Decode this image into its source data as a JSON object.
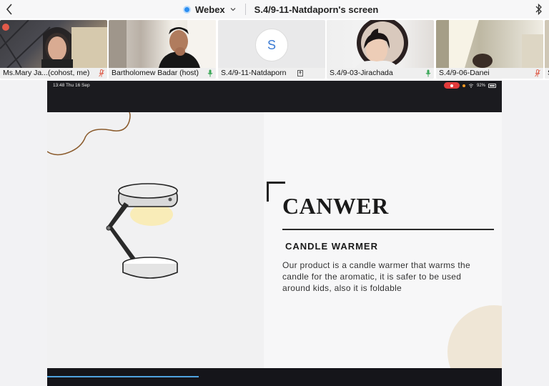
{
  "topbar": {
    "app_name": "Webex",
    "share_title": "S.4/9-11-Natdaporn's screen"
  },
  "participants": [
    {
      "label": "Ms.Mary Ja...(cohost, me)",
      "mic": "muted"
    },
    {
      "label": "Bartholomew Badar (host)",
      "mic": "active"
    },
    {
      "label": "S.4/9-11-Natdaporn",
      "avatar_initial": "S",
      "mic": "sharing"
    },
    {
      "label": "S.4/9-03-Jirachada",
      "mic": "active"
    },
    {
      "label": "S.4/9-06-Danei",
      "mic": "muted"
    },
    {
      "label": "S"
    }
  ],
  "ipad_status": {
    "time": "13:48  Thu 16 Sep",
    "battery": "92%"
  },
  "slide": {
    "title": "CANWER",
    "subtitle": "CANDLE WARMER",
    "body": "Our product is a candle warmer that warms the candle for the aromatic, it is safer to be used around kids, also it is foldable"
  },
  "colors": {
    "accent": "#2b8ef2",
    "muted_mic": "#e06b5a",
    "active_mic": "#3aa757",
    "progress": "#4fa3e0"
  }
}
